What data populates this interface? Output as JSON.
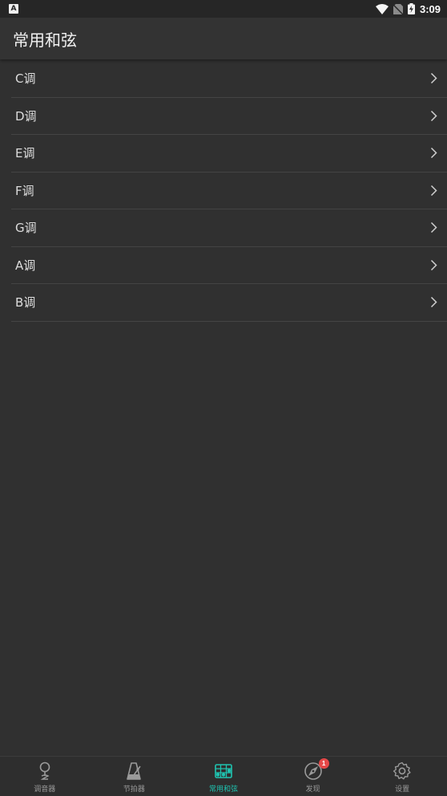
{
  "status_bar": {
    "notification_badge": "A",
    "time": "3:09"
  },
  "app_bar": {
    "title": "常用和弦"
  },
  "keys": [
    {
      "label": "C调"
    },
    {
      "label": "D调"
    },
    {
      "label": "E调"
    },
    {
      "label": "F调"
    },
    {
      "label": "G调"
    },
    {
      "label": "A调"
    },
    {
      "label": "B调"
    }
  ],
  "bottom_nav": {
    "items": [
      {
        "label": "调音器",
        "icon": "tuner-icon"
      },
      {
        "label": "节拍器",
        "icon": "metronome-icon"
      },
      {
        "label": "常用和弦",
        "icon": "chord-icon",
        "active": true
      },
      {
        "label": "发现",
        "icon": "compass-icon",
        "badge": "1"
      },
      {
        "label": "设置",
        "icon": "gear-icon"
      }
    ]
  },
  "colors": {
    "accent": "#1fc3b0",
    "background": "#303030",
    "badge": "#e54848"
  }
}
